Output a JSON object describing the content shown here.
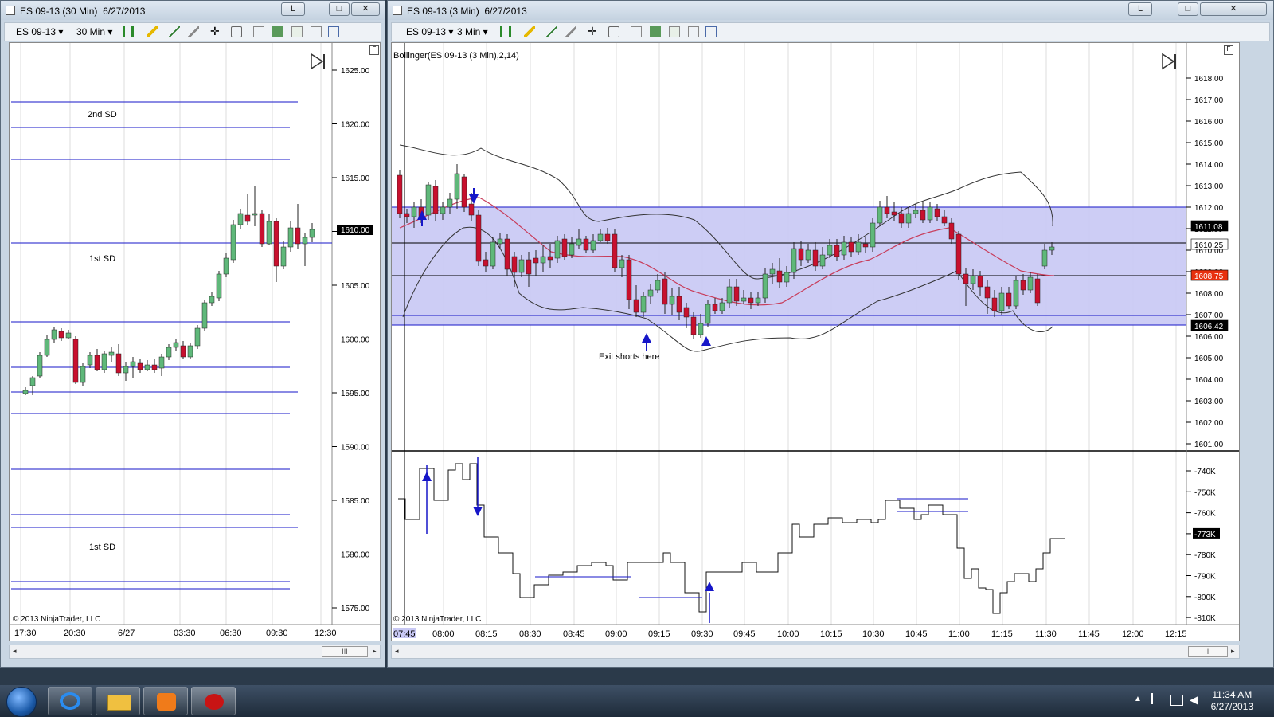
{
  "left_window": {
    "title": "ES 09-13 (30 Min)",
    "date": "6/27/2013",
    "instrument": "ES 09-13",
    "interval": "30 Min",
    "price_labels": [
      "1625.00",
      "1620.00",
      "1615.00",
      "1610.00",
      "1605.00",
      "1600.00",
      "1595.00",
      "1590.00",
      "1585.00",
      "1580.00",
      "1575.00"
    ],
    "current_price": "1610.00",
    "time_labels": [
      "17:30",
      "20:30",
      "6/27",
      "03:30",
      "06:30",
      "09:30",
      "12:30"
    ],
    "annotations": [
      "2nd SD",
      "1st SD",
      "1st SD"
    ],
    "copyright": "© 2013 NinjaTrader, LLC",
    "scroll_thumb": "III"
  },
  "right_window": {
    "title": "ES 09-13 (3 Min)",
    "date": "6/27/2013",
    "instrument": "ES 09-13",
    "interval": "3 Min",
    "indicator_label": "Bollinger(ES 09-13 (3 Min),2,14)",
    "price_labels": [
      "1618.00",
      "1617.00",
      "1616.00",
      "1615.00",
      "1614.00",
      "1613.00",
      "1612.00",
      "1611.00",
      "1610.00",
      "1609.00",
      "1608.00",
      "1607.00",
      "1606.00",
      "1605.00",
      "1604.00",
      "1603.00",
      "1602.00",
      "1601.00"
    ],
    "price_tags": [
      {
        "text": "1611.08",
        "color": "#000000"
      },
      {
        "text": "1610.25",
        "color": "#000000"
      },
      {
        "text": "1608.75",
        "color": "#e8300e"
      },
      {
        "text": "1606.42",
        "color": "#000000"
      }
    ],
    "lower_labels": [
      "-740K",
      "-750K",
      "-760K",
      "-773K",
      "-780K",
      "-790K",
      "-800K",
      "-810K"
    ],
    "time_labels": [
      "07:45",
      "08:00",
      "08:15",
      "08:30",
      "08:45",
      "09:00",
      "09:15",
      "09:30",
      "09:45",
      "10:00",
      "10:15",
      "10:30",
      "10:45",
      "11:00",
      "11:15",
      "11:30",
      "11:45",
      "12:00",
      "12:15"
    ],
    "annotation": "Exit shorts here",
    "copyright": "© 2013 NinjaTrader, LLC",
    "scroll_thumb": "III"
  },
  "window_buttons": {
    "minimize": "L",
    "maximize": "□",
    "close": "✕"
  },
  "taskbar": {
    "time": "11:34 AM",
    "date": "6/27/2013",
    "apps": [
      "start-orb-icon",
      "internet-explorer-icon",
      "file-explorer-icon",
      "media-player-icon",
      "ninjatrader-icon"
    ]
  },
  "colors": {
    "band_fill": "#c8c8f4",
    "blue_line": "#1616c8",
    "up_candle": "#5fb87a",
    "down_candle": "#c8102e",
    "ma_line": "#c83c5a"
  }
}
